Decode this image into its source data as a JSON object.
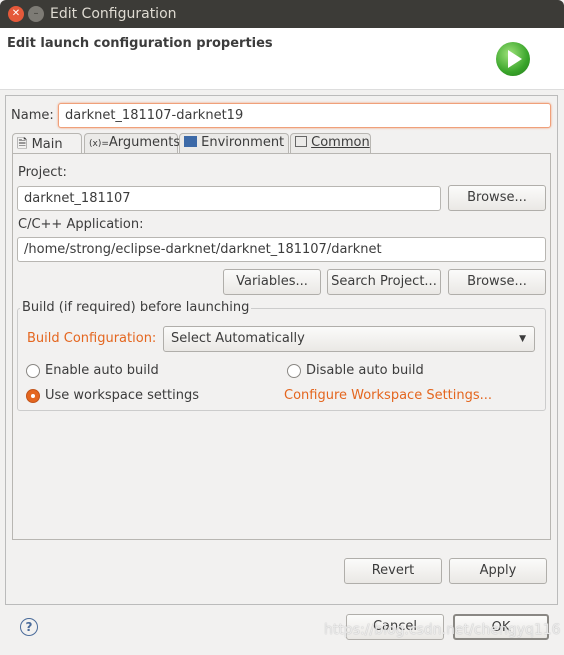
{
  "window": {
    "title": "Edit Configuration"
  },
  "header": {
    "title": "Edit launch configuration properties",
    "icon": "run-icon"
  },
  "name": {
    "label": "Name:",
    "value": "darknet_181107-darknet19"
  },
  "tabs": [
    {
      "label": "Main",
      "icon": "file-icon"
    },
    {
      "label": "Arguments",
      "icon": "variable-icon"
    },
    {
      "label": "Environment",
      "icon": "environment-icon"
    },
    {
      "label": "Common",
      "icon": "table-icon"
    }
  ],
  "main": {
    "project_label": "Project:",
    "project_value": "darknet_181107",
    "browse": "Browse...",
    "app_label": "C/C++ Application:",
    "app_value": "/home/strong/eclipse-darknet/darknet_181107/darknet",
    "variables": "Variables...",
    "search_project": "Search Project...",
    "build_group": "Build (if required) before launching",
    "build_config_label": "Build Configuration:",
    "build_config_value": "Select Automatically",
    "enable_auto": "Enable auto build",
    "disable_auto": "Disable auto build",
    "use_workspace": "Use workspace settings",
    "configure_workspace": "Configure Workspace Settings..."
  },
  "buttons": {
    "revert": "Revert",
    "apply": "Apply",
    "cancel": "Cancel",
    "ok": "OK"
  },
  "watermark": "https://blog.csdn.net/chengyq116",
  "colors": {
    "accent": "#e4661f",
    "titlebar": "#3c3b37"
  }
}
